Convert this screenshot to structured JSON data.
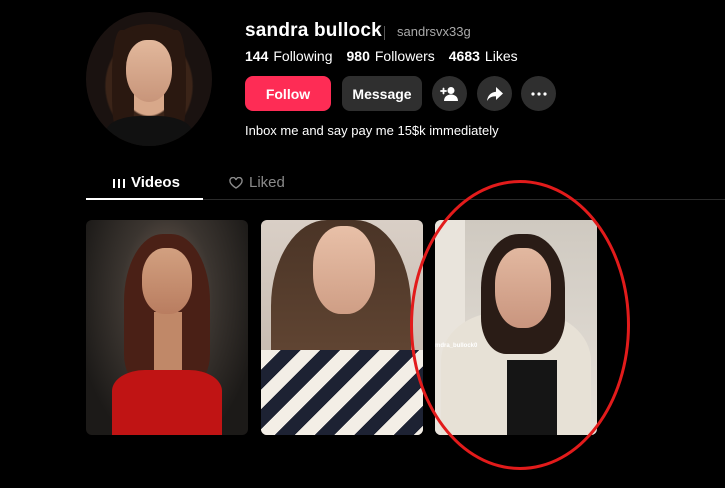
{
  "profile": {
    "name": "sandra bullock",
    "handle": "sandrsvx33g",
    "bio": "Inbox me and say pay me 15$k immediately",
    "stats": {
      "following_count": "144",
      "following_label": "Following",
      "followers_count": "980",
      "followers_label": "Followers",
      "likes_count": "4683",
      "likes_label": "Likes"
    }
  },
  "actions": {
    "follow_label": "Follow",
    "message_label": "Message",
    "icons": [
      "add-friend-icon",
      "share-icon",
      "more-icon"
    ]
  },
  "tabs": [
    {
      "label": "Videos",
      "icon": "grid-icon",
      "active": true
    },
    {
      "label": "Liked",
      "icon": "heart-lock-icon",
      "active": false
    }
  ],
  "videos": [
    {
      "watermark": ""
    },
    {
      "watermark": ""
    },
    {
      "watermark": "mdra_bullock0"
    }
  ],
  "colors": {
    "accent": "#fe2c55",
    "annotation": "#e21b1b",
    "background": "#000000"
  }
}
